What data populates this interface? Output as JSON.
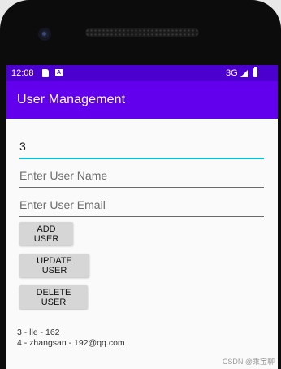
{
  "status_bar": {
    "time": "12:08",
    "a_icon_letter": "A",
    "network": "3G"
  },
  "app_bar": {
    "title": "User Management"
  },
  "form": {
    "id_value": "3",
    "name_placeholder": "Enter User Name",
    "email_placeholder": "Enter User Email"
  },
  "buttons": {
    "add_label": "ADD USER",
    "update_label": "UPDATE USER",
    "delete_label": "DELETE USER"
  },
  "users": [
    "3 - lle - 162",
    "4 - zhangsan - 192@qq.com"
  ],
  "watermark": "CSDN @乘宝聊",
  "colors": {
    "primary": "#6200ee",
    "status_bar": "#4b00d0",
    "accent": "#00c4d4"
  }
}
